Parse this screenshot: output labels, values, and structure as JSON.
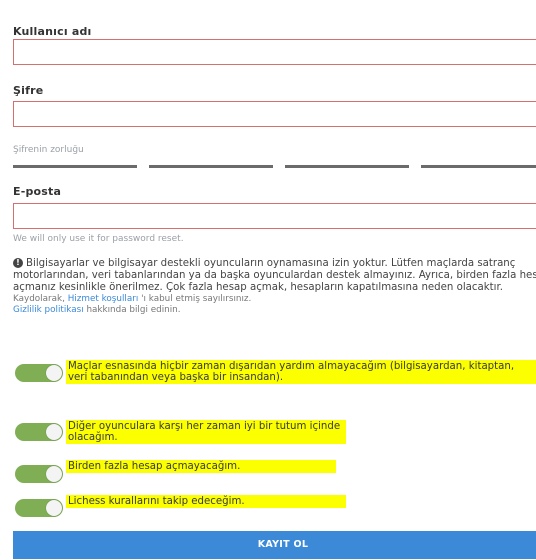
{
  "form": {
    "username": {
      "label": "Kullanıcı adı",
      "value": ""
    },
    "password": {
      "label": "Şifre",
      "value": ""
    },
    "strength": {
      "label": "Şifrenin zorluğu",
      "level": 0
    },
    "email": {
      "label": "E-posta",
      "value": "",
      "helper": "We will only use it for password reset."
    }
  },
  "notice": {
    "text": "Bilgisayarlar ve bilgisayar destekli oyuncuların oynamasına izin yoktur. Lütfen maçlarda satranç motorlarından, veri tabanlarından ya da başka oyunculardan destek almayınız. Ayrıca, birden fazla hesap açmanız kesinlikle önerilmez. Çok fazla hesap açmak, hesapların kapatılmasına neden olacaktır.",
    "terms_prefix": "Kaydolarak, ",
    "terms_link": "Hizmet koşulları",
    "terms_suffix": " 'ı kabul etmiş sayılırsınız.",
    "privacy_link": "Gizlilik politikası",
    "privacy_suffix": " hakkında bilgi edinin."
  },
  "agreements": [
    {
      "text": "Maçlar esnasında hiçbir zaman dışarıdan yardım almayacağım (bilgisayardan, kitaptan, veri tabanından veya başka bir insandan).",
      "checked": true
    },
    {
      "text": "Diğer oyunculara karşı her zaman iyi bir tutum içinde olacağım.",
      "checked": true
    },
    {
      "text": "Birden fazla hesap açmayacağım.",
      "checked": true
    },
    {
      "text": "Lichess kurallarını takip edeceğim.",
      "checked": true
    }
  ],
  "submit": {
    "label": "KAYIT OL"
  },
  "colors": {
    "error_border": "#d4706f",
    "toggle_on": "#7fae55",
    "highlight": "#fbff00",
    "primary": "#3c8ad7"
  }
}
